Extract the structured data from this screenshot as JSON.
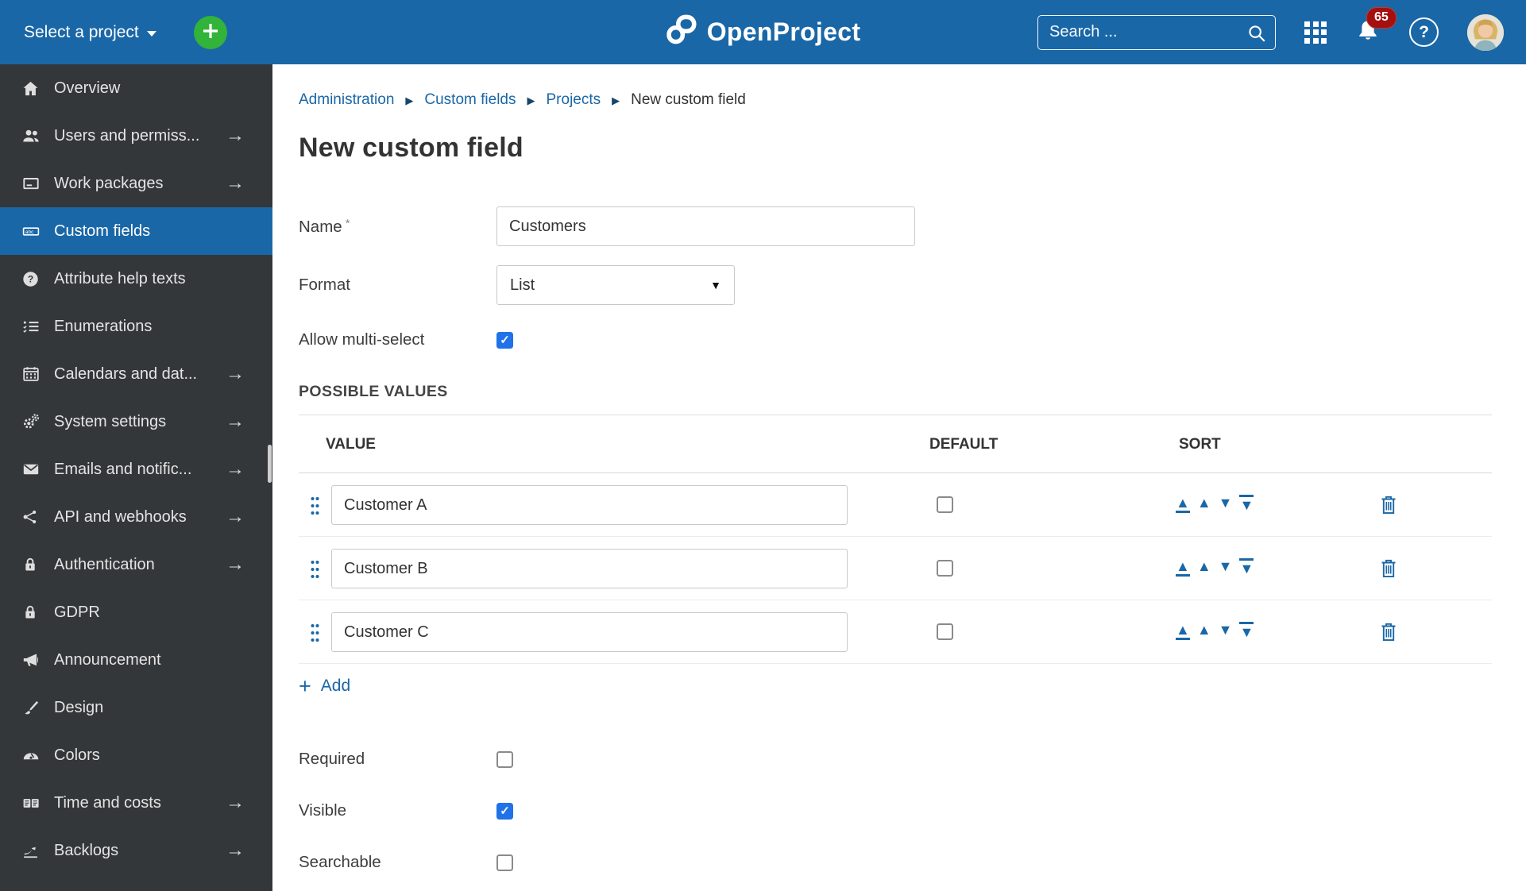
{
  "header": {
    "select_project_label": "Select a project",
    "logo_text": "OpenProject",
    "search_placeholder": "Search ...",
    "notification_count": "65",
    "colors": {
      "header_bg": "#1A67A7",
      "create_green": "#32b33a",
      "badge_red": "#a50f0f"
    }
  },
  "sidebar": {
    "items": [
      {
        "label": "Overview",
        "icon": "home",
        "arrow": false,
        "active": false
      },
      {
        "label": "Users and permiss...",
        "icon": "users",
        "arrow": true,
        "active": false
      },
      {
        "label": "Work packages",
        "icon": "work",
        "arrow": true,
        "active": false
      },
      {
        "label": "Custom fields",
        "icon": "customfield",
        "arrow": false,
        "active": true
      },
      {
        "label": "Attribute help texts",
        "icon": "help",
        "arrow": false,
        "active": false
      },
      {
        "label": "Enumerations",
        "icon": "enum",
        "arrow": false,
        "active": false
      },
      {
        "label": "Calendars and dat...",
        "icon": "calendar",
        "arrow": true,
        "active": false
      },
      {
        "label": "System settings",
        "icon": "gears",
        "arrow": true,
        "active": false
      },
      {
        "label": "Emails and notific...",
        "icon": "envelope",
        "arrow": true,
        "active": false
      },
      {
        "label": "API and webhooks",
        "icon": "share",
        "arrow": true,
        "active": false
      },
      {
        "label": "Authentication",
        "icon": "lock",
        "arrow": true,
        "active": false
      },
      {
        "label": "GDPR",
        "icon": "lock",
        "arrow": false,
        "active": false
      },
      {
        "label": "Announcement",
        "icon": "megaphone",
        "arrow": false,
        "active": false
      },
      {
        "label": "Design",
        "icon": "brush",
        "arrow": false,
        "active": false
      },
      {
        "label": "Colors",
        "icon": "gauge",
        "arrow": false,
        "active": false
      },
      {
        "label": "Time and costs",
        "icon": "money",
        "arrow": true,
        "active": false
      },
      {
        "label": "Backlogs",
        "icon": "backlogs",
        "arrow": true,
        "active": false
      }
    ]
  },
  "breadcrumb": {
    "items": [
      "Administration",
      "Custom fields",
      "Projects",
      "New custom field"
    ]
  },
  "page": {
    "title": "New custom field"
  },
  "form": {
    "name": {
      "label": "Name",
      "required_marker": "*",
      "value": "Customers"
    },
    "format": {
      "label": "Format",
      "value": "List"
    },
    "multi_select": {
      "label": "Allow multi-select",
      "checked": true
    },
    "possible_values": {
      "heading": "POSSIBLE VALUES",
      "columns": [
        "VALUE",
        "DEFAULT",
        "SORT"
      ],
      "rows": [
        {
          "value": "Customer A",
          "default": false
        },
        {
          "value": "Customer B",
          "default": false
        },
        {
          "value": "Customer C",
          "default": false
        }
      ],
      "add_label": "Add"
    },
    "required": {
      "label": "Required",
      "checked": false
    },
    "visible": {
      "label": "Visible",
      "checked": true
    },
    "searchable": {
      "label": "Searchable",
      "checked": false
    }
  }
}
